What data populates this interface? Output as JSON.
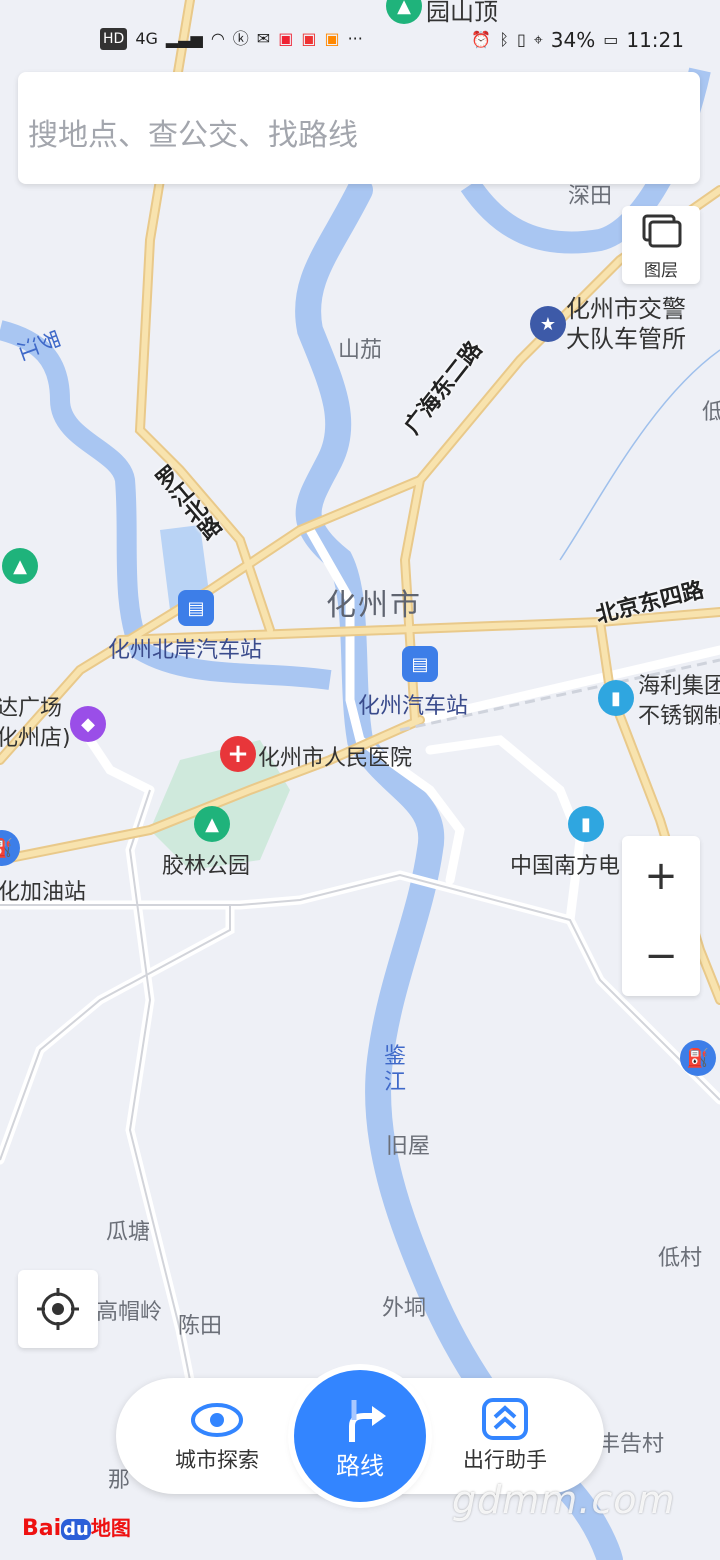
{
  "status_bar": {
    "left_icons": [
      "hd-icon",
      "4g-signal-icon",
      "wifi-icon",
      "k-app-icon",
      "mail-icon",
      "app1-icon",
      "app2-icon",
      "app3-icon",
      "more-dots-icon"
    ],
    "hd": "HD",
    "network": "4G",
    "dots": "···",
    "battery": "34%",
    "time": "11:21"
  },
  "search": {
    "placeholder": "搜地点、查公交、找路线"
  },
  "layer_button": {
    "label": "图层"
  },
  "zoom": {
    "in": "+",
    "out": "−"
  },
  "map_labels": {
    "top_park": "园山顶",
    "shentian": "深田",
    "shanqie": "山茄",
    "traffic_police": "化州市交警\n大队车管所",
    "luojiang_river": "罗江",
    "luojiang_north_rd": "罗江北路",
    "guanghai_east_rd": "广海东二路",
    "city": "化州市",
    "beian_station": "化州北岸汽车站",
    "bus_station": "化州汽车站",
    "beijing_east_rd": "北京东四路",
    "haili": "海利集团\n不锈钢制",
    "plaza": "达广场\n化州店)",
    "hospital": "化州市人民医院",
    "jiaolin_park": "胶林公园",
    "southern_power": "中国南方电",
    "gas_station": "化加油站",
    "jianjiang": "鉴\n江",
    "jiuwu": "旧屋",
    "guatang": "瓜塘",
    "gaomaoling": "高帽岭",
    "chentian": "陈田",
    "waitong": "外垌",
    "dicun": "低村",
    "fenggaocun": "丰告村",
    "na": "那",
    "di_right": "低"
  },
  "bottom_bar": {
    "explore": "城市探索",
    "route": "路线",
    "assistant": "出行助手"
  },
  "logo": {
    "bai": "Bai",
    "du": "du",
    "map": "地图"
  },
  "watermark": "gdmm.com",
  "colors": {
    "accent": "#3385ff",
    "water": "#a9c6f2",
    "road_main": "#f6dda0",
    "hospital": "#e8363a",
    "park": "#1fb37b",
    "bus": "#3d7ee8"
  }
}
